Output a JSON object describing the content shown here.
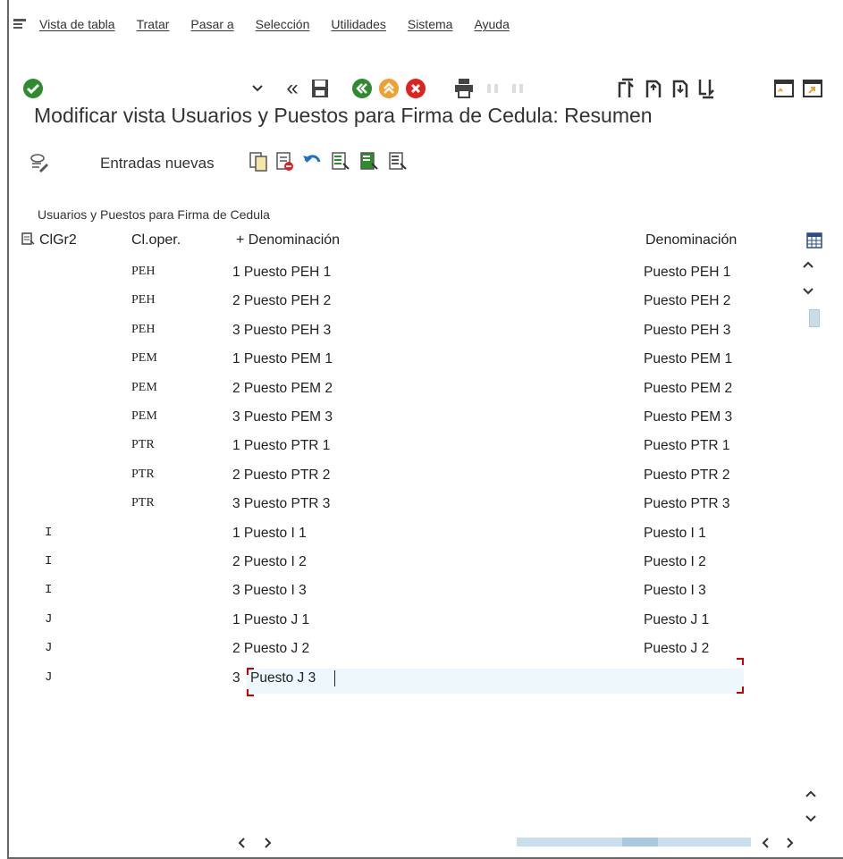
{
  "menu": {
    "items": [
      "Vista de tabla",
      "Tratar",
      "Pasar a",
      "Selección",
      "Utilidades",
      "Sistema",
      "Ayuda"
    ]
  },
  "toolbar": {
    "command_field_value": "",
    "icons": [
      "enter-check-icon",
      "dropdown-chevron-icon",
      "history-back-icon",
      "save-icon",
      "back-icon",
      "exit-icon",
      "cancel-icon",
      "print-icon",
      "find-icon",
      "find-next-icon",
      "first-page-icon",
      "previous-page-icon",
      "next-page-icon",
      "last-page-icon",
      "create-session-icon",
      "shortcut-icon"
    ]
  },
  "title": "Modificar vista Usuarios y Puestos para Firma de Cedula: Resumen",
  "app_toolbar": {
    "new_entries": "Entradas nuevas",
    "icons": [
      "display-change-icon",
      "copy-as-icon",
      "delete-icon",
      "undo-icon",
      "select-all-icon",
      "select-block-icon",
      "deselect-all-icon"
    ]
  },
  "table": {
    "section_title": "Usuarios y Puestos para Firma de Cedula",
    "headers": {
      "col1": "ClGr2",
      "col2": "Cl.oper.",
      "col3": "+ Denominación",
      "col4": "Denominación"
    },
    "rows": [
      {
        "clgr2": "",
        "cloper": "PEH",
        "den1": "1 Puesto PEH 1",
        "den2": "Puesto PEH 1"
      },
      {
        "clgr2": "",
        "cloper": "PEH",
        "den1": "2 Puesto PEH 2",
        "den2": "Puesto PEH 2"
      },
      {
        "clgr2": "",
        "cloper": "PEH",
        "den1": "3 Puesto PEH 3",
        "den2": "Puesto PEH 3"
      },
      {
        "clgr2": "",
        "cloper": "PEM",
        "den1": "1 Puesto PEM 1",
        "den2": "Puesto PEM 1"
      },
      {
        "clgr2": "",
        "cloper": "PEM",
        "den1": "2 Puesto PEM 2",
        "den2": "Puesto PEM 2"
      },
      {
        "clgr2": "",
        "cloper": "PEM",
        "den1": "3 Puesto PEM 3",
        "den2": "Puesto PEM 3"
      },
      {
        "clgr2": "",
        "cloper": "PTR",
        "den1": "1 Puesto PTR 1",
        "den2": "Puesto PTR 1"
      },
      {
        "clgr2": "",
        "cloper": "PTR",
        "den1": "2 Puesto PTR 2",
        "den2": "Puesto PTR 2"
      },
      {
        "clgr2": "",
        "cloper": "PTR",
        "den1": "3 Puesto PTR 3",
        "den2": "Puesto PTR 3"
      },
      {
        "clgr2": "I",
        "cloper": "",
        "den1": "1 Puesto I 1",
        "den2": "Puesto I 1"
      },
      {
        "clgr2": "I",
        "cloper": "",
        "den1": "2 Puesto I 2",
        "den2": "Puesto I 2"
      },
      {
        "clgr2": "I",
        "cloper": "",
        "den1": "3 Puesto I 3",
        "den2": "Puesto I 3"
      },
      {
        "clgr2": "J",
        "cloper": "",
        "den1": "1 Puesto J 1",
        "den2": "Puesto J 1"
      },
      {
        "clgr2": "J",
        "cloper": "",
        "den1": "2 Puesto J 2",
        "den2": "Puesto J 2"
      }
    ],
    "edit_row": {
      "clgr2": "J",
      "prefix": "3",
      "value": "Puesto J 3"
    }
  }
}
